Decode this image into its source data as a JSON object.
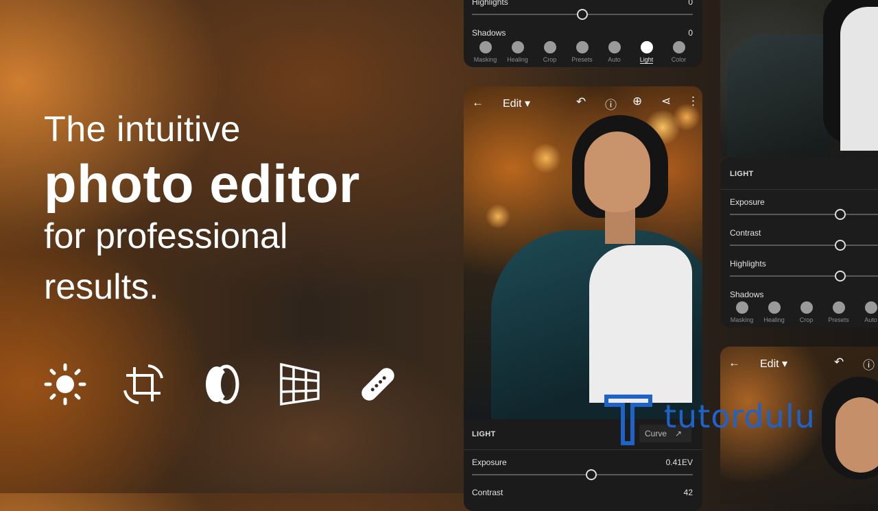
{
  "hero": {
    "line1": "The intuitive",
    "line2": "photo editor",
    "line3": "for professional",
    "line4": "results."
  },
  "feature_icons": [
    "light-sun-icon",
    "crop-rotate-icon",
    "lens-optics-icon",
    "geometry-grid-icon",
    "healing-bandage-icon"
  ],
  "top_panel": {
    "rows": [
      {
        "label": "Highlights",
        "value": "0"
      },
      {
        "label": "Shadows",
        "value": "0"
      }
    ],
    "tools": [
      "Masking",
      "Healing",
      "Crop",
      "Presets",
      "Auto",
      "Light",
      "Color"
    ],
    "active_tool": "Light"
  },
  "main_phone": {
    "edit_label": "Edit",
    "panel_title": "LIGHT",
    "curve_label": "Curve",
    "rows": [
      {
        "label": "Exposure",
        "value": "0.41EV"
      },
      {
        "label": "Contrast",
        "value": "42"
      }
    ]
  },
  "right_panel": {
    "title": "LIGHT",
    "rows": [
      {
        "label": "Exposure"
      },
      {
        "label": "Contrast"
      },
      {
        "label": "Highlights"
      },
      {
        "label": "Shadows"
      }
    ],
    "tools": [
      "Masking",
      "Healing",
      "Crop",
      "Presets",
      "Auto"
    ]
  },
  "right_bottom": {
    "edit_label": "Edit"
  },
  "watermark": {
    "text": "tutordulu",
    "color": "#1f63c9"
  }
}
